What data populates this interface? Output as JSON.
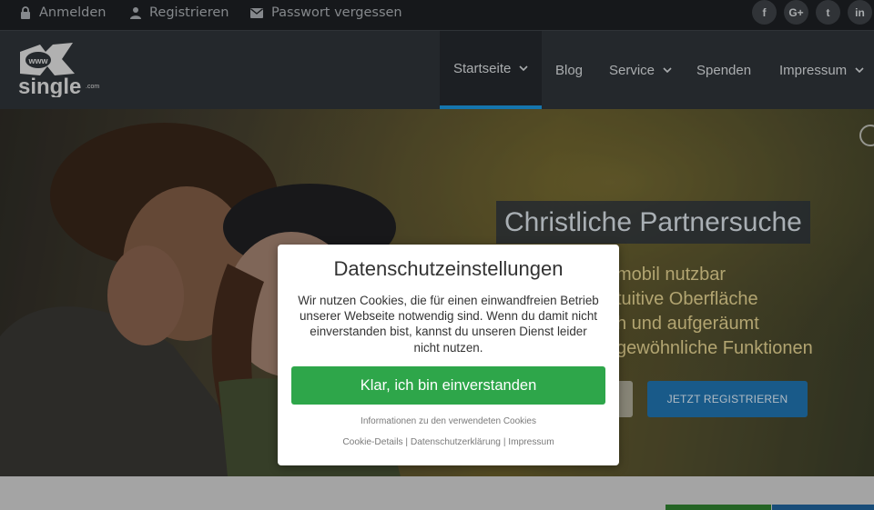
{
  "topbar": {
    "login": "Anmelden",
    "register": "Registrieren",
    "forgot": "Passwort vergessen",
    "social": [
      {
        "icon": "facebook-icon",
        "glyph": "f"
      },
      {
        "icon": "google-plus-icon",
        "glyph": "G+"
      },
      {
        "icon": "twitter-icon",
        "glyph": "t"
      },
      {
        "icon": "linkedin-icon",
        "glyph": "in"
      }
    ]
  },
  "logo": {
    "text_www": "www",
    "text_brand": "single",
    "text_tld": ".com"
  },
  "nav": {
    "items": [
      "Startseite",
      "Blog",
      "Service",
      "Spenden",
      "Impressum"
    ]
  },
  "hero": {
    "title": "Christliche Partnersuche",
    "lines": [
      "mobil nutzbar",
      "tuitive Oberfläche",
      "h und aufgeräumt",
      "gewöhnliche Funktionen"
    ],
    "register_button": "JETZT REGISTRIEREN"
  },
  "modal": {
    "title": "Datenschutzeinstellungen",
    "text": "Wir nutzen Cookies, die für einen einwandfreien Betrieb unserer Webseite notwendig sind. Wenn du damit nicht einverstanden bist, kannst du unseren Dienst leider nicht nutzen.",
    "accept": "Klar, ich bin einverstanden",
    "info": "Informationen zu den verwendeten Cookies",
    "cookie_details": "Cookie-Details",
    "privacy": "Datenschutzerklärung",
    "imprint": "Impressum",
    "separator": " | "
  },
  "colors": {
    "accent": "#1a8fd4",
    "accept_green": "#2ea64a",
    "register_blue": "#1f6ea8"
  }
}
